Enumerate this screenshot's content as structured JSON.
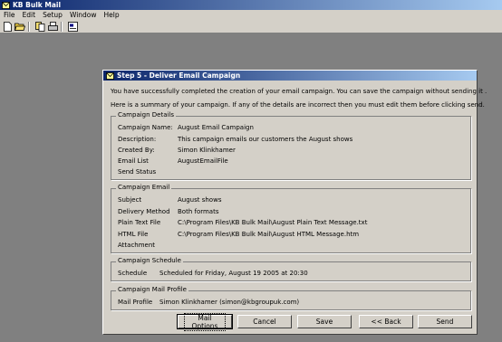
{
  "app": {
    "title": "KB Bulk Mail"
  },
  "menu": [
    "File",
    "Edit",
    "Setup",
    "Window",
    "Help"
  ],
  "toolbar_icons": [
    "new-icon",
    "open-icon",
    "copy-icon",
    "print-icon",
    "properties-icon"
  ],
  "dialog": {
    "title": "Step 5 - Deliver Email Campaign",
    "intro1": "You have successfully completed the creation of your email campaign.  You can save the campaign without sending it .",
    "intro2": "Here is a summary of your campaign.  If any of the details are incorrect then you must edit them before clicking send."
  },
  "details": {
    "legend": "Campaign Details",
    "rows": [
      {
        "label": "Campaign Name:",
        "value": "August Email Campaign"
      },
      {
        "label": "Description:",
        "value": "This campaign emails our customers the August shows"
      },
      {
        "label": "Created By:",
        "value": "Simon Klinkhamer"
      },
      {
        "label": "Email List",
        "value": "AugustEmailFile"
      },
      {
        "label": "Send Status",
        "value": ""
      }
    ]
  },
  "email": {
    "legend": "Campaign Email",
    "rows": [
      {
        "label": "Subject",
        "value": "August shows"
      },
      {
        "label": "Delivery Method",
        "value": "Both formats"
      },
      {
        "label": "Plain Text File",
        "value": "C:\\Program Files\\KB Bulk Mail\\August Plain Text Message.txt"
      },
      {
        "label": "HTML File",
        "value": "C:\\Program Files\\KB Bulk Mail\\August HTML Message.htm"
      },
      {
        "label": "Attachment",
        "value": ""
      }
    ]
  },
  "schedule": {
    "legend": "Campaign Schedule",
    "label": "Schedule",
    "value": "Scheduled for Friday, August 19 2005 at 20:30"
  },
  "profile": {
    "legend": "Campaign Mail Profile",
    "label": "Mail Profile",
    "value": "Simon Klinkhamer (simon@kbgroupuk.com)"
  },
  "buttons": {
    "mail_options": "Mail Options",
    "cancel": "Cancel",
    "save": "Save",
    "back": "<< Back",
    "send": "Send"
  }
}
